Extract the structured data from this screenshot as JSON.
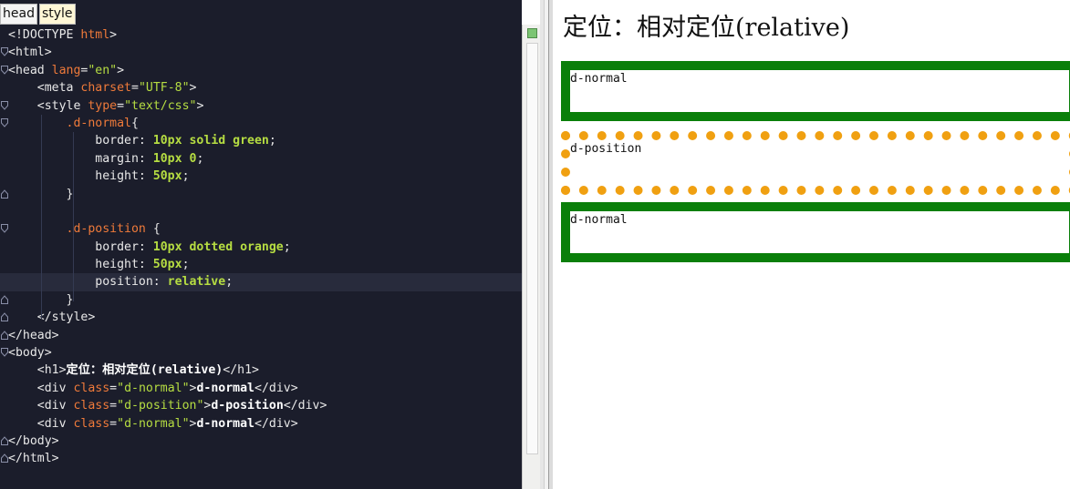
{
  "breadcrumb": [
    "head",
    "style"
  ],
  "code_lines": [
    [
      {
        "c": "t-tag",
        "t": "<!DOCTYPE "
      },
      {
        "c": "t-attr",
        "t": "html"
      },
      {
        "c": "t-tag",
        "t": ">"
      }
    ],
    [
      {
        "c": "t-tag",
        "t": "<html>"
      }
    ],
    [
      {
        "c": "t-tag",
        "t": "<head "
      },
      {
        "c": "t-attr",
        "t": "lang"
      },
      {
        "c": "t-tag",
        "t": "="
      },
      {
        "c": "t-str",
        "t": "\"en\""
      },
      {
        "c": "t-tag",
        "t": ">"
      }
    ],
    [
      {
        "c": "t-tag",
        "t": "    <meta "
      },
      {
        "c": "t-attr",
        "t": "charset"
      },
      {
        "c": "t-tag",
        "t": "="
      },
      {
        "c": "t-str",
        "t": "\"UTF-8\""
      },
      {
        "c": "t-tag",
        "t": ">"
      }
    ],
    [
      {
        "c": "t-tag",
        "t": "    <style "
      },
      {
        "c": "t-attr",
        "t": "type"
      },
      {
        "c": "t-tag",
        "t": "="
      },
      {
        "c": "t-str",
        "t": "\"text/css\""
      },
      {
        "c": "t-tag",
        "t": ">"
      }
    ],
    [
      {
        "c": "t-punc",
        "t": "        "
      },
      {
        "c": "t-sel",
        "t": ".d-normal"
      },
      {
        "c": "t-punc",
        "t": "{"
      }
    ],
    [
      {
        "c": "t-prop",
        "t": "            border: "
      },
      {
        "c": "t-val",
        "t": "10px solid green"
      },
      {
        "c": "t-punc",
        "t": ";"
      }
    ],
    [
      {
        "c": "t-prop",
        "t": "            margin: "
      },
      {
        "c": "t-val",
        "t": "10px 0"
      },
      {
        "c": "t-punc",
        "t": ";"
      }
    ],
    [
      {
        "c": "t-prop",
        "t": "            height: "
      },
      {
        "c": "t-val",
        "t": "50px"
      },
      {
        "c": "t-punc",
        "t": ";"
      }
    ],
    [
      {
        "c": "t-punc",
        "t": "        }"
      }
    ],
    [
      {
        "c": "t-punc",
        "t": ""
      }
    ],
    [
      {
        "c": "t-punc",
        "t": "        "
      },
      {
        "c": "t-sel",
        "t": ".d-position"
      },
      {
        "c": "t-punc",
        "t": " {"
      }
    ],
    [
      {
        "c": "t-prop",
        "t": "            border: "
      },
      {
        "c": "t-val",
        "t": "10px dotted orange"
      },
      {
        "c": "t-punc",
        "t": ";"
      }
    ],
    [
      {
        "c": "t-prop",
        "t": "            height: "
      },
      {
        "c": "t-val",
        "t": "50px"
      },
      {
        "c": "t-punc",
        "t": ";"
      }
    ],
    [
      {
        "c": "t-prop",
        "t": "            position: "
      },
      {
        "c": "t-val",
        "t": "relative"
      },
      {
        "c": "t-punc",
        "t": ";"
      }
    ],
    [
      {
        "c": "t-punc",
        "t": "        }"
      }
    ],
    [
      {
        "c": "t-tag",
        "t": "    </style>"
      }
    ],
    [
      {
        "c": "t-tag",
        "t": "</head>"
      }
    ],
    [
      {
        "c": "t-tag",
        "t": "<body>"
      }
    ],
    [
      {
        "c": "t-tag",
        "t": "    <h1>"
      },
      {
        "c": "t-bold",
        "t": "定位：相对定位(relative)"
      },
      {
        "c": "t-tag",
        "t": "</h1>"
      }
    ],
    [
      {
        "c": "t-tag",
        "t": "    <div "
      },
      {
        "c": "t-attr",
        "t": "class"
      },
      {
        "c": "t-tag",
        "t": "="
      },
      {
        "c": "t-str",
        "t": "\"d-normal\""
      },
      {
        "c": "t-tag",
        "t": ">"
      },
      {
        "c": "t-bold",
        "t": "d-normal"
      },
      {
        "c": "t-tag",
        "t": "</div>"
      }
    ],
    [
      {
        "c": "t-tag",
        "t": "    <div "
      },
      {
        "c": "t-attr",
        "t": "class"
      },
      {
        "c": "t-tag",
        "t": "="
      },
      {
        "c": "t-str",
        "t": "\"d-position\""
      },
      {
        "c": "t-tag",
        "t": ">"
      },
      {
        "c": "t-bold",
        "t": "d-position"
      },
      {
        "c": "t-tag",
        "t": "</div>"
      }
    ],
    [
      {
        "c": "t-tag",
        "t": "    <div "
      },
      {
        "c": "t-attr",
        "t": "class"
      },
      {
        "c": "t-tag",
        "t": "="
      },
      {
        "c": "t-str",
        "t": "\"d-normal\""
      },
      {
        "c": "t-tag",
        "t": ">"
      },
      {
        "c": "t-bold",
        "t": "d-normal"
      },
      {
        "c": "t-tag",
        "t": "</div>"
      }
    ],
    [
      {
        "c": "t-tag",
        "t": "</body>"
      }
    ],
    [
      {
        "c": "t-tag",
        "t": "</html>"
      }
    ]
  ],
  "preview": {
    "title": "定位：相对定位(relative)",
    "boxes": [
      "d-normal",
      "d-position",
      "d-normal"
    ]
  },
  "colors": {
    "editor_bg": "#1b1d2b",
    "green_border": "#0a7f0a",
    "orange_border": "#f0a011"
  }
}
